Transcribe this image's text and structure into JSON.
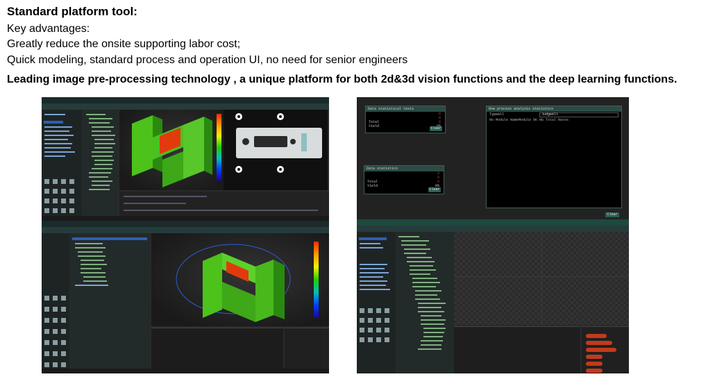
{
  "heading": {
    "title": "Standard platform tool:",
    "advantages_label": "Key advantages:",
    "line1": "Greatly reduce the onsite supporting labor cost;",
    "line2": "Quick modeling, standard process and operation UI, no need for senior engineers",
    "headline": "Leading image pre-processing technology ,  a unique platform for both 2d&3d vision functions and the deep learning functions."
  },
  "colors": {
    "background": "#ffffff",
    "panel": "#2a2a2a",
    "window_border": "#3f5f52",
    "button": "#2f5b55",
    "error_text": "#d03030"
  },
  "screens": {
    "stats_top": {
      "title": "Data statistical tests",
      "rows": [
        {
          "label": "",
          "value": "0"
        },
        {
          "label": "",
          "value": "0"
        },
        {
          "label": "Total",
          "value": "0"
        },
        {
          "label": "Yield",
          "value": "0%"
        }
      ],
      "clear_label": "Clear"
    },
    "stats_bottom": {
      "title": "Data statistics",
      "rows": [
        {
          "label": "",
          "value": "0"
        },
        {
          "label": "",
          "value": "0"
        },
        {
          "label": "Total",
          "value": "0"
        },
        {
          "label": "Yield",
          "value": "0%"
        }
      ],
      "clear_label": "Clear"
    },
    "process": {
      "title": "Row process analysis statistics",
      "select_label": "TypeAll",
      "select_value": "JudgeAll",
      "columns": "No Module NameModule OK NG Total Rates"
    },
    "main_clear_label": "Clear"
  }
}
